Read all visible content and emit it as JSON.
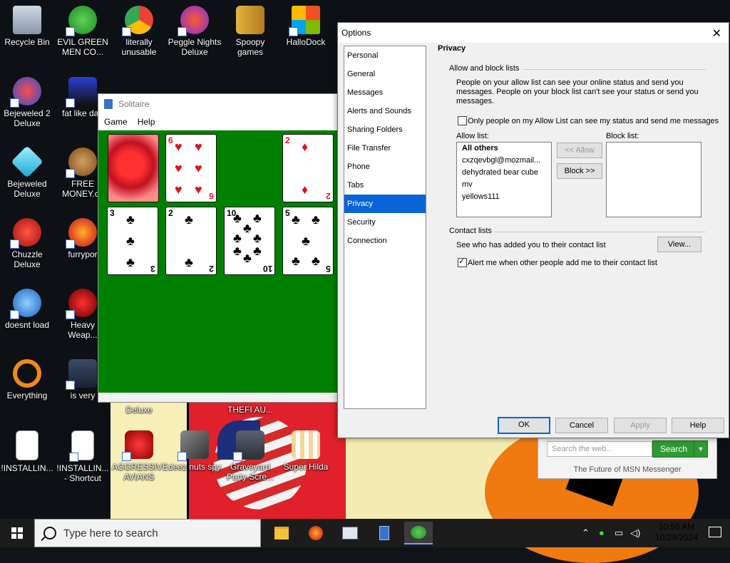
{
  "desktop": {
    "icons": [
      {
        "label": "Recycle Bin"
      },
      {
        "label": "EVIL GREEN MEN CO..."
      },
      {
        "label": "literally unusable"
      },
      {
        "label": "Peggle Nights Deluxe"
      },
      {
        "label": "Spoopy games"
      },
      {
        "label": "HalloDock"
      },
      {
        "label": "Bejeweled 2 Deluxe"
      },
      {
        "label": "fat like darl"
      },
      {
        "label": "Bejeweled Deluxe"
      },
      {
        "label": "FREE MONEY.cc"
      },
      {
        "label": "Chuzzle Deluxe"
      },
      {
        "label": "furrypor"
      },
      {
        "label": "doesnt load"
      },
      {
        "label": "Heavy Weap..."
      },
      {
        "label": "Everything"
      },
      {
        "label": "is very"
      },
      {
        "label": "!INSTALLIN..."
      },
      {
        "label": "!INSTALLIN... - Shortcut"
      },
      {
        "label": "AGGRESSIVE AVIANS"
      },
      {
        "label": "deez nuts spy"
      },
      {
        "label": "Graveyard Party Scre..."
      },
      {
        "label": "Super Hilda"
      }
    ],
    "partial_labels": {
      "deluxe": "Deluxe",
      "thefi": "THEFI AU..."
    }
  },
  "solitaire": {
    "title": "Solitaire",
    "menu": [
      "Game",
      "Help"
    ],
    "cards": [
      {
        "rank": "6",
        "suit": "♥",
        "color": "red"
      },
      {
        "rank": "2",
        "suit": "♦",
        "color": "red"
      },
      {
        "rank": "3",
        "suit": "♣",
        "color": "black"
      },
      {
        "rank": "2",
        "suit": "♣",
        "color": "black"
      },
      {
        "rank": "10",
        "suit": "♣",
        "color": "black"
      },
      {
        "rank": "5",
        "suit": "♣",
        "color": "black"
      }
    ]
  },
  "options": {
    "title": "Options",
    "close": "✕",
    "nav": [
      "Personal",
      "General",
      "Messages",
      "Alerts and Sounds",
      "Sharing Folders",
      "File Transfer",
      "Phone",
      "Tabs",
      "Privacy",
      "Security",
      "Connection"
    ],
    "selected_nav": "Privacy",
    "heading": "Privacy",
    "allow_block": {
      "group": "Allow and block lists",
      "description": "People on your allow list can see your online status and send you messages.  People on your block list can't see your status or send you messages.",
      "only_allow_label": "Only people on my Allow List can see my status and send me messages",
      "only_allow_checked": false,
      "allow_list_label": "Allow list:",
      "block_list_label": "Block list:",
      "allow_list": [
        "All others",
        "cxzqevbgl@mozmail...",
        "dehydrated bear cube",
        "mv",
        "yellows111"
      ],
      "block_list": [],
      "allow_button": "<< Allow",
      "block_button": "Block >>"
    },
    "contact_lists": {
      "group": "Contact lists",
      "see_who": "See who has added you to their contact list",
      "view_button": "View...",
      "alert_label": "Alert me when other people add me to their contact list",
      "alert_checked": true
    },
    "buttons": {
      "ok": "OK",
      "cancel": "Cancel",
      "apply": "Apply",
      "help": "Help"
    }
  },
  "msn_search": {
    "placeholder": "Search the web...",
    "button": "Search",
    "footer": "The Future of MSN Messenger"
  },
  "taskbar": {
    "search_placeholder": "Type here to search",
    "time": "10:58 AM",
    "date": "10/29/2024"
  }
}
